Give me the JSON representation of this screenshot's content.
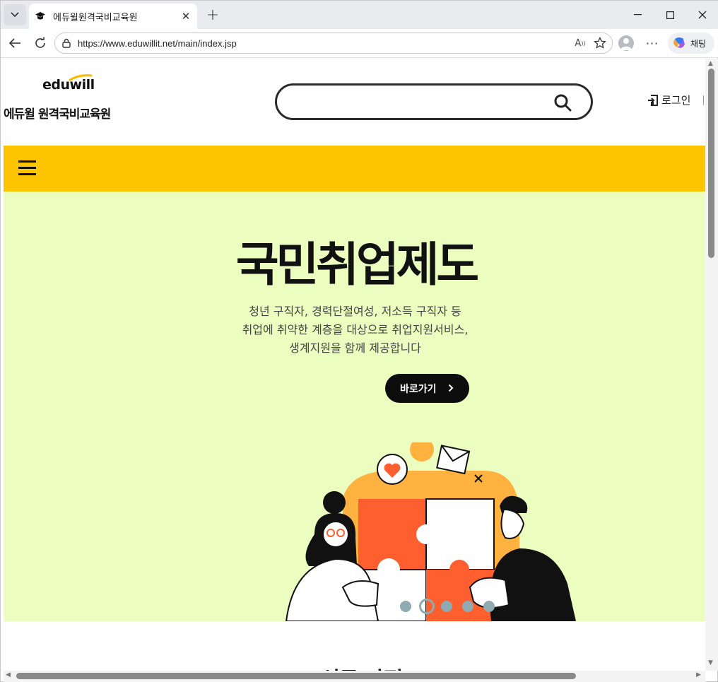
{
  "browser": {
    "tab_title": "에듀윌원격국비교육원",
    "url": "https://www.eduwillit.net/main/index.jsp",
    "copilot_label": "채팅"
  },
  "header": {
    "logo_en": "eduwill",
    "logo_ko": "에듀윌 원격국비교육원",
    "search_placeholder": "",
    "login_label": "로그인"
  },
  "hero": {
    "title": "국민취업제도",
    "desc_lines": [
      "청년 구직자, 경력단절여성, 저소득 구직자 등",
      "취업에 취약한 계층을 대상으로 취업지원서비스,",
      "생계지원을 함께 제공합니다"
    ],
    "button_label": "바로가기",
    "slides_total": 5,
    "slide_active": 2
  },
  "section": {
    "title": "신규 과정"
  },
  "colors": {
    "gnb": "#fcc500",
    "hero_bg": "#ebfec0",
    "button_bg": "#0d0d0d",
    "puzzle_orange": "#ff5f2e",
    "sun_orange": "#ffb23f"
  }
}
